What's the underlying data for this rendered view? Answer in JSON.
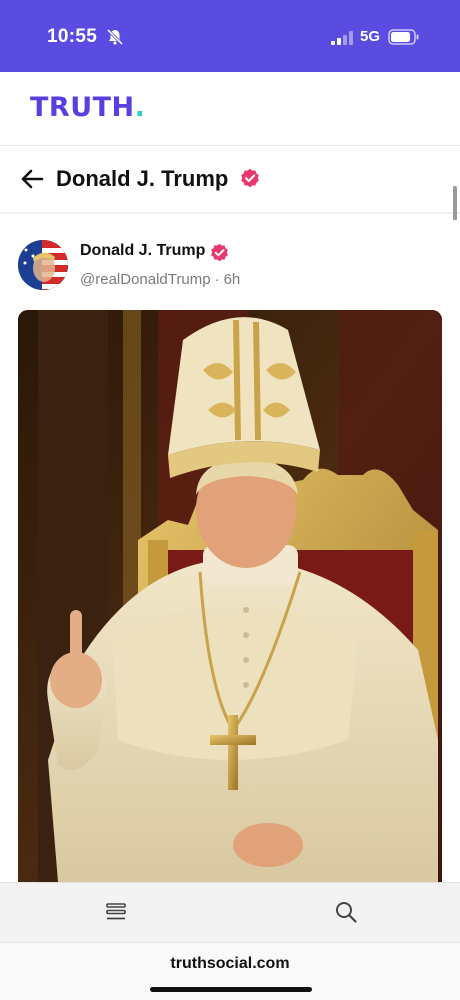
{
  "status_bar": {
    "time": "10:55",
    "network": "5G",
    "bg_color": "#5a4ce0"
  },
  "brand": {
    "logo_text": "TRUTH",
    "logo_dot": ".",
    "logo_color": "#5a3fe0",
    "dot_color": "#2fd3c2"
  },
  "profile_header": {
    "title": "Donald J. Trump",
    "verified_color": "#e8386d"
  },
  "post": {
    "author_name": "Donald J. Trump",
    "handle": "@realDonaldTrump",
    "separator": "·",
    "time_ago": "6h"
  },
  "browser": {
    "url": "truthsocial.com"
  },
  "icons": {
    "status": [
      "bell-slash-icon",
      "signal-icon",
      "battery-icon"
    ],
    "header": [
      "back-arrow-icon",
      "verified-badge-icon"
    ],
    "tab_bar": [
      "menu-icon",
      "search-icon"
    ]
  }
}
